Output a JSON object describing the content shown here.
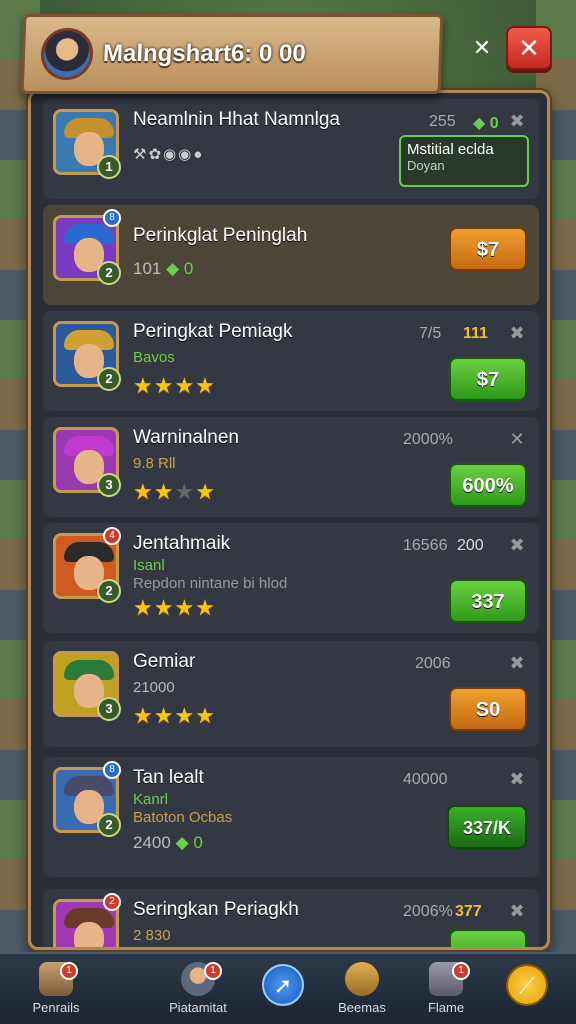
{
  "header": {
    "title": "Malngshart6: 0 00",
    "small_close": "✕",
    "close": "✕"
  },
  "rows": [
    {
      "name": "Neamlnin Hhat Namnlga",
      "level": "1",
      "stat1": "255",
      "stat2": "0",
      "sub_icons": "⚒✿◉◉●",
      "box_title": "Mstitial eclda",
      "box_sub": "Doyan",
      "corner": "✖"
    },
    {
      "name": "Perinkglat Peninglah",
      "level": "2",
      "badge": "8",
      "sub": "101",
      "sub_gem": "0",
      "button": "$7"
    },
    {
      "name": "Peringkat Pemiagk",
      "level": "2",
      "stat1": "7/5",
      "stat2": "111",
      "sub": "Bavos",
      "stars": 4,
      "button": "$7",
      "corner": "✖"
    },
    {
      "name": "Warninalnen",
      "level": "3",
      "stat1": "2000%",
      "sub": "9.8 Rll",
      "stars": 3,
      "button": "600%",
      "corner": "✕"
    },
    {
      "name": "Jentahmaik",
      "level": "2",
      "badge": "4",
      "stat1": "16566",
      "stat2": "200",
      "sub": "Isanl",
      "sub2": "Repdon nintane bi hlod",
      "stars": 4,
      "button": "337",
      "corner": "✖"
    },
    {
      "name": "Gemiar",
      "level": "3",
      "stat1": "2006",
      "sub": "21000",
      "stars": 4,
      "button": "S0",
      "corner": "✖"
    },
    {
      "name": "Tan lealt",
      "level": "2",
      "badge": "8",
      "stat1": "40000",
      "sub": "Kanrl",
      "sub2": "Batoton Ocbas",
      "sub3": "2400",
      "sub3_gem": "0",
      "button": "337/K",
      "corner": "✖"
    },
    {
      "name": "Seringkan Periagkh",
      "level": "2",
      "badge": "2",
      "stat1": "2006%",
      "stat2": "377",
      "sub": "2 830",
      "corner": "✖"
    }
  ],
  "nav": [
    {
      "label": "Penrails",
      "badge": "1"
    },
    {
      "label": "Piatamitat",
      "badge": "1"
    },
    {
      "label": ""
    },
    {
      "label": "Beemas"
    },
    {
      "label": "Flame",
      "badge": "1"
    },
    {
      "label": ""
    }
  ],
  "colors": {
    "accent_gold": "#f0c030",
    "green": "#6ad04a",
    "orange": "#f0a030",
    "red": "#d03a2a"
  }
}
